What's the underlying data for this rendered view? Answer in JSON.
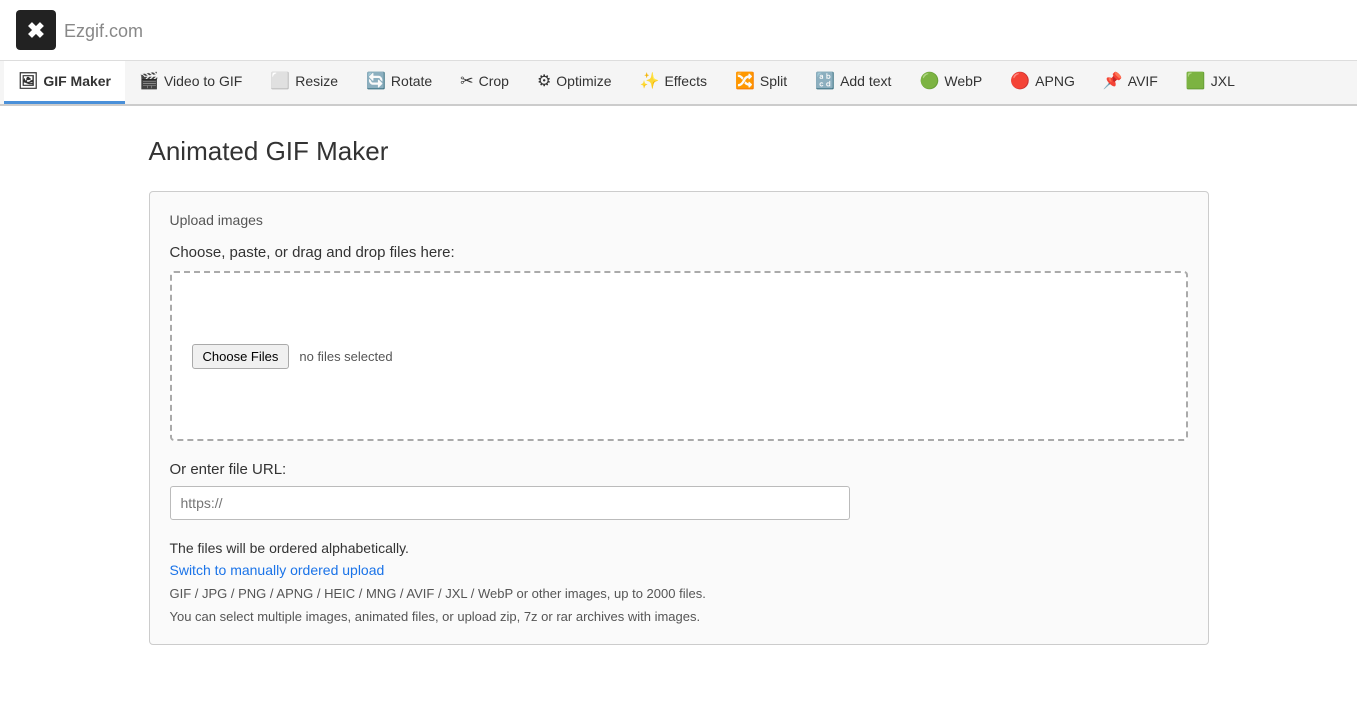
{
  "logo": {
    "text": "Ezgif",
    "suffix": ".com",
    "icon": "✖"
  },
  "nav": {
    "items": [
      {
        "id": "gif-maker",
        "label": "GIF Maker",
        "icon": "🖼",
        "active": true
      },
      {
        "id": "video-to-gif",
        "label": "Video to GIF",
        "icon": "🎬",
        "active": false
      },
      {
        "id": "resize",
        "label": "Resize",
        "icon": "⬜",
        "active": false
      },
      {
        "id": "rotate",
        "label": "Rotate",
        "icon": "🔄",
        "active": false
      },
      {
        "id": "crop",
        "label": "Crop",
        "icon": "✂",
        "active": false
      },
      {
        "id": "optimize",
        "label": "Optimize",
        "icon": "⚙",
        "active": false
      },
      {
        "id": "effects",
        "label": "Effects",
        "icon": "✨",
        "active": false
      },
      {
        "id": "split",
        "label": "Split",
        "icon": "🔀",
        "active": false
      },
      {
        "id": "add-text",
        "label": "Add text",
        "icon": "🔡",
        "active": false
      },
      {
        "id": "webp",
        "label": "WebP",
        "icon": "🟢",
        "active": false
      },
      {
        "id": "apng",
        "label": "APNG",
        "icon": "🔴",
        "active": false
      },
      {
        "id": "avif",
        "label": "AVIF",
        "icon": "📌",
        "active": false
      },
      {
        "id": "jxl",
        "label": "JXL",
        "icon": "🟩",
        "active": false
      }
    ]
  },
  "main": {
    "title": "Animated GIF Maker",
    "upload_section_title": "Upload images",
    "upload_label": "Choose, paste, or drag and drop files here:",
    "choose_files_btn": "Choose Files",
    "no_files_text": "no files selected",
    "url_label": "Or enter file URL:",
    "url_placeholder": "https://",
    "info_text_1": "The files will be ordered alphabetically.",
    "info_link_text": "Switch to manually ordered upload",
    "info_text_2": "GIF / JPG / PNG / APNG / HEIC / MNG / AVIF / JXL / WebP or other images, up to 2000 files.",
    "info_text_3": "You can select multiple images, animated files, or upload zip, 7z or rar archives with images."
  }
}
